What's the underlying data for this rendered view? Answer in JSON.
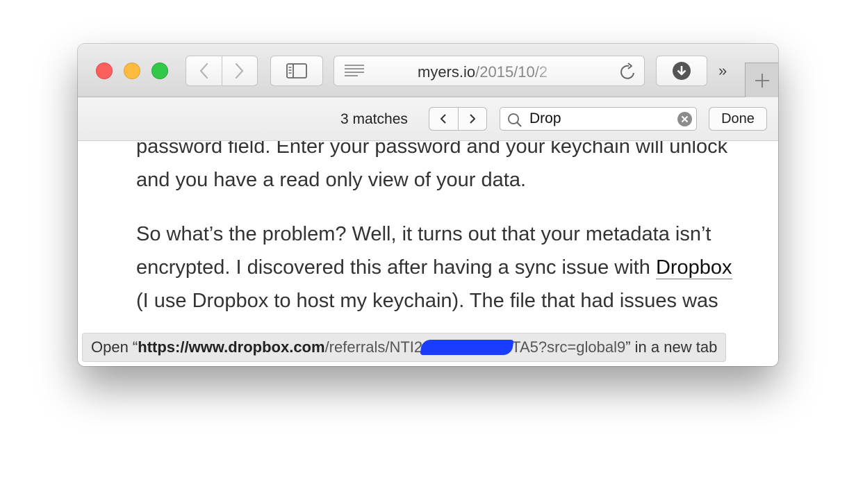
{
  "toolbar": {
    "address_host": "myers.io",
    "address_path": "/2015/10/2",
    "overflow_glyph": "»"
  },
  "findbar": {
    "matches_label": "3 matches",
    "search_value": "Drop",
    "done_label": "Done"
  },
  "article": {
    "p1": "password field. Enter your password and your keychain will unlock and you have a read only view of your data.",
    "p2_before": "So what’s the problem? Well, it turns out that your metadata isn’t encrypted. I discovered this after having a sync issue with ",
    "p2_link": "Dropbox",
    "p2_after": " (I use Dropbox to host my keychain). The file that had issues was"
  },
  "status_bar": {
    "prefix": "Open “",
    "host": "https://www.dropbox.com",
    "path": "/referrals/NTI2",
    "redacted": true,
    "path_end": "TA5?src=global9",
    "suffix": "” in a new tab"
  },
  "colors": {
    "close": "#fc605c",
    "minimize": "#fdbc40",
    "maximize": "#34c84a",
    "redaction": "#1a3cff"
  }
}
